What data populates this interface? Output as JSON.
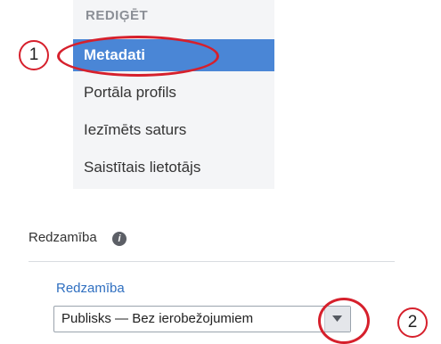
{
  "menu": {
    "heading": "REDIĢĒT",
    "items": [
      {
        "label": "Metadati",
        "active": true
      },
      {
        "label": "Portāla profils",
        "active": false
      },
      {
        "label": "Iezīmēts saturs",
        "active": false
      },
      {
        "label": "Saistītais lietotājs",
        "active": false
      }
    ]
  },
  "visibility_section": {
    "label": "Redzamība",
    "info_icon": "info-icon",
    "field_label": "Redzamība",
    "select_value": "Publisks — Bez ierobežojumiem",
    "dropdown_icon": "chevron-down-icon"
  },
  "callouts": [
    "1",
    "2"
  ],
  "colors": {
    "active_item_bg": "#4a86d6",
    "callout_red": "#d6202c",
    "field_label_blue": "#2f6fc0"
  }
}
